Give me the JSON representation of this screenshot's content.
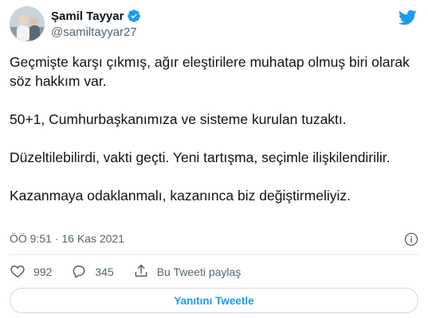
{
  "author": {
    "name": "Şamil Tayyar",
    "handle": "@samiltayyar27"
  },
  "tweet": {
    "paragraphs": [
      "Geçmişte karşı çıkmış, ağır eleştirilere muhatap olmuş biri olarak söz hakkım var.",
      "50+1, Cumhurbaşkanımıza ve sisteme kurulan tuzaktı.",
      "Düzeltilebilirdi, vakti geçti. Yeni tartışma, seçimle ilişkilendirilir.",
      "Kazanmaya odaklanmalı, kazanınca biz değiştirmeliyiz."
    ],
    "timestamp": "ÖÖ 9:51 · 16 Kas 2021"
  },
  "actions": {
    "likes": "992",
    "replies": "345",
    "share_label": "Bu Tweeti paylaş"
  },
  "reply_button_label": "Yanıtını Tweetle",
  "colors": {
    "accent": "#1d9bf0",
    "secondary_text": "#536471",
    "divider": "#e7ecf0"
  },
  "icons": [
    "verified-badge-icon",
    "twitter-bird-icon",
    "info-icon",
    "heart-icon",
    "reply-icon",
    "share-icon"
  ]
}
